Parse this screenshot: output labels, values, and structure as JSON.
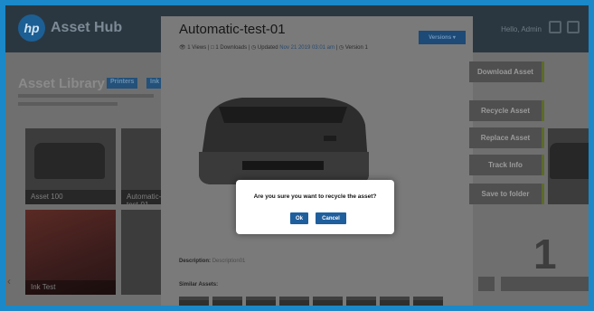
{
  "header": {
    "logo_text": "hp",
    "brand": "Asset Hub",
    "user_text": "Hello, Admin"
  },
  "library": {
    "title": "Asset Library",
    "chips": [
      "Printers",
      "Ink"
    ],
    "tile_captions": [
      "Asset 100",
      "Automatic-test-01",
      "Ink Test"
    ]
  },
  "modal": {
    "title": "Automatic-test-01",
    "meta": {
      "views": "1 Views",
      "downloads": "1 Downloads",
      "updated_label": "Updated",
      "updated_value": "Nov 21 2019 03:01 am",
      "version_label": "Version",
      "version_value": "1"
    },
    "versions_button": "Versions",
    "description_label": "Description:",
    "description_value": "Description01",
    "similar_assets_label": "Similar Assets:"
  },
  "actions": [
    "Download Asset",
    "Recycle Asset",
    "Replace Asset",
    "Track Info",
    "Save to folder"
  ],
  "dialog": {
    "message": "Are you sure you want to recycle the asset?",
    "ok_label": "Ok",
    "cancel_label": "Cancel"
  },
  "colors": {
    "frame": "#1a88c9",
    "primary_button": "#1f5f9e",
    "action_accent": "#5c6b2a"
  }
}
